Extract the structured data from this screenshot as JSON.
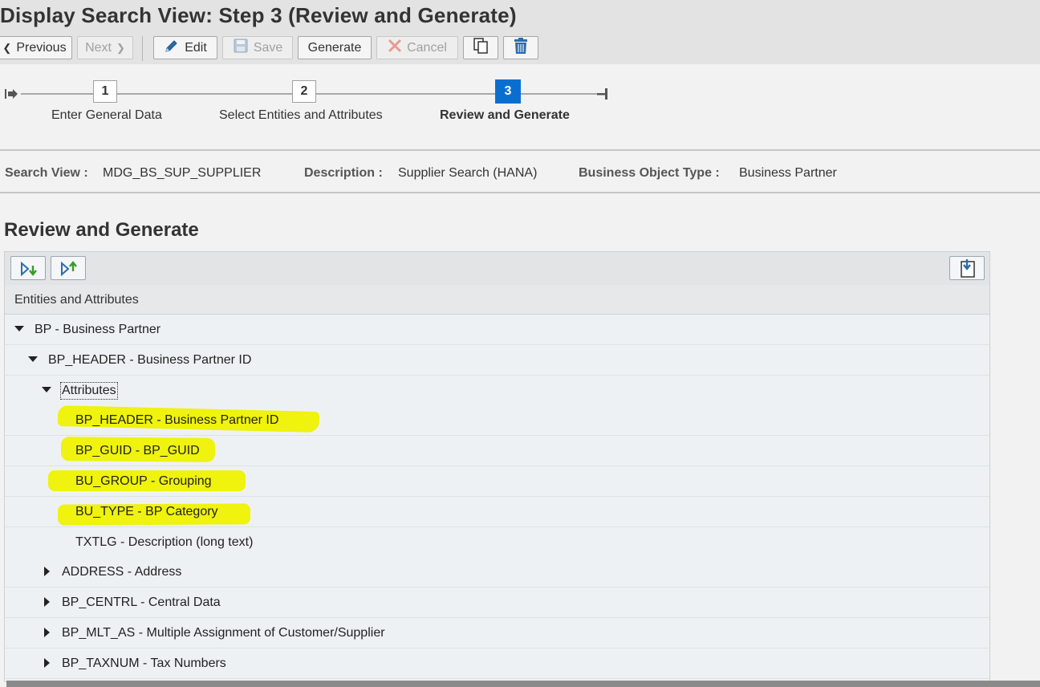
{
  "window": {
    "title": "Display Search View: Step 3  (Review and Generate)"
  },
  "toolbar": {
    "previous": "Previous",
    "next": "Next",
    "edit": "Edit",
    "save": "Save",
    "generate": "Generate",
    "cancel": "Cancel",
    "icons": [
      "chevron-left-icon",
      "chevron-right-icon",
      "pencil-icon",
      "save-icon",
      "close-icon",
      "copy-icon",
      "trash-icon"
    ]
  },
  "roadmap": {
    "steps": [
      {
        "number": "1",
        "label": "Enter General Data",
        "active": false
      },
      {
        "number": "2",
        "label": "Select Entities and Attributes",
        "active": false
      },
      {
        "number": "3",
        "label": "Review and Generate",
        "active": true
      }
    ]
  },
  "info": {
    "search_view_label": "Search View :",
    "search_view_value": "MDG_BS_SUP_SUPPLIER",
    "description_label": "Description :",
    "description_value": "Supplier Search (HANA)",
    "bo_type_label": "Business Object Type :",
    "bo_type_value": "Business Partner"
  },
  "section": {
    "title": "Review and Generate"
  },
  "tree": {
    "toolbar_icons": [
      "expand-all-icon",
      "collapse-all-icon",
      "export-icon"
    ],
    "column_header": "Entities and Attributes",
    "rows": [
      {
        "label": "BP - Business Partner",
        "state": "expanded",
        "highlighted": false
      },
      {
        "label": "BP_HEADER - Business Partner ID",
        "state": "expanded",
        "highlighted": false
      },
      {
        "label": "Attributes",
        "state": "expanded",
        "highlighted": false
      },
      {
        "label": "BP_HEADER - Business Partner ID",
        "state": "leaf",
        "highlighted": true
      },
      {
        "label": "BP_GUID - BP_GUID",
        "state": "leaf",
        "highlighted": true
      },
      {
        "label": "BU_GROUP - Grouping",
        "state": "leaf",
        "highlighted": true
      },
      {
        "label": "BU_TYPE - BP Category",
        "state": "leaf",
        "highlighted": true
      },
      {
        "label": "TXTLG - Description (long text)",
        "state": "leaf",
        "highlighted": false
      },
      {
        "label": "ADDRESS - Address",
        "state": "collapsed",
        "highlighted": false
      },
      {
        "label": "BP_CENTRL - Central Data",
        "state": "collapsed",
        "highlighted": false
      },
      {
        "label": "BP_MLT_AS - Multiple Assignment of Customer/Supplier",
        "state": "collapsed",
        "highlighted": false
      },
      {
        "label": "BP_TAXNUM - Tax Numbers",
        "state": "collapsed",
        "highlighted": false
      }
    ]
  },
  "colors": {
    "accent": "#0a6ed1",
    "highlight": "#eef200",
    "toolbar_bg": "#e3e3e3"
  }
}
